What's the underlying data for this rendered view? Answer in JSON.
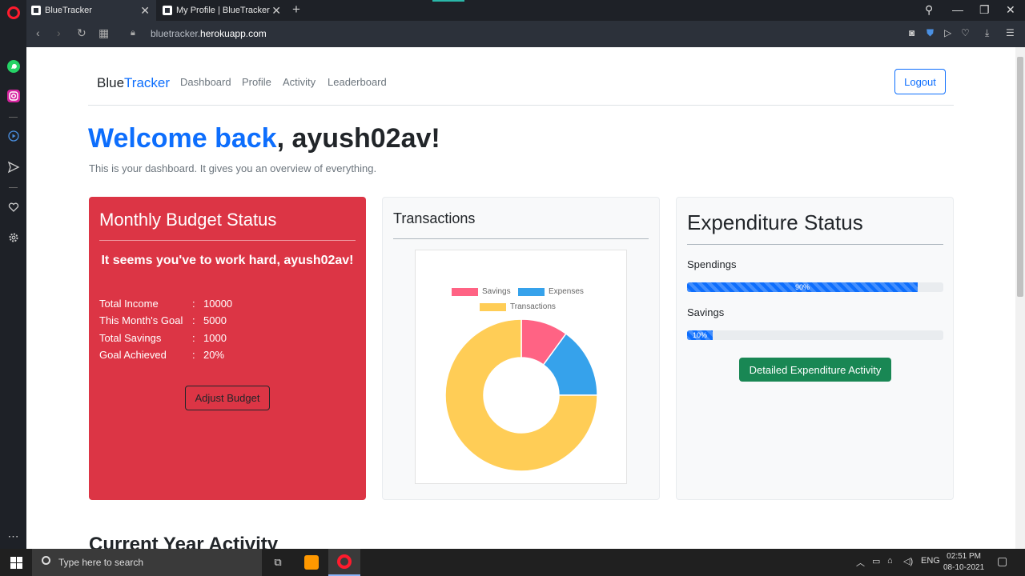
{
  "browser": {
    "tabs": [
      {
        "title": "BlueTracker",
        "active": true
      },
      {
        "title": "My Profile | BlueTracker",
        "active": false
      }
    ],
    "url_prefix": "bluetracker.",
    "url_domain": "herokuapp.com"
  },
  "site": {
    "brand_part1": "Blue",
    "brand_part2": "Tracker",
    "nav": [
      "Dashboard",
      "Profile",
      "Activity",
      "Leaderboard"
    ],
    "logout": "Logout"
  },
  "hero": {
    "welcome": "Welcome back",
    "username_suffix": ", ayush02av!",
    "lead": "This is your dashboard. It gives you an overview of everything."
  },
  "budget": {
    "title": "Monthly Budget Status",
    "message": "It seems you've to work hard, ayush02av!",
    "stats": [
      {
        "label": "Total Income",
        "sep": ":",
        "value": "10000"
      },
      {
        "label": "This Month's Goal",
        "sep": ":",
        "value": "5000"
      },
      {
        "label": "Total Savings",
        "sep": ":",
        "value": "1000"
      },
      {
        "label": "Goal Achieved",
        "sep": ":",
        "value": "20%"
      }
    ],
    "adjust_button": "Adjust Budget"
  },
  "transactions": {
    "title": "Transactions",
    "chart_data": {
      "type": "pie",
      "labels": [
        "Savings",
        "Expenses",
        "Transactions"
      ],
      "values": [
        1000,
        1500,
        7500
      ],
      "colors": [
        "#ff6384",
        "#36a2eb",
        "#ffcd56"
      ]
    }
  },
  "expenditure": {
    "title": "Expenditure Status",
    "bars": [
      {
        "label": "Spendings",
        "percent": 90,
        "text": "90%"
      },
      {
        "label": "Savings",
        "percent": 10,
        "text": "10%"
      }
    ],
    "button": "Detailed Expenditure Activity"
  },
  "section_heading": "Current Year Activity",
  "taskbar": {
    "search_placeholder": "Type here to search",
    "lang": "ENG",
    "time": "02:51 PM",
    "date": "08-10-2021"
  },
  "colors": {
    "primary": "#0d6efd",
    "danger": "#dc3545",
    "success": "#198754"
  }
}
